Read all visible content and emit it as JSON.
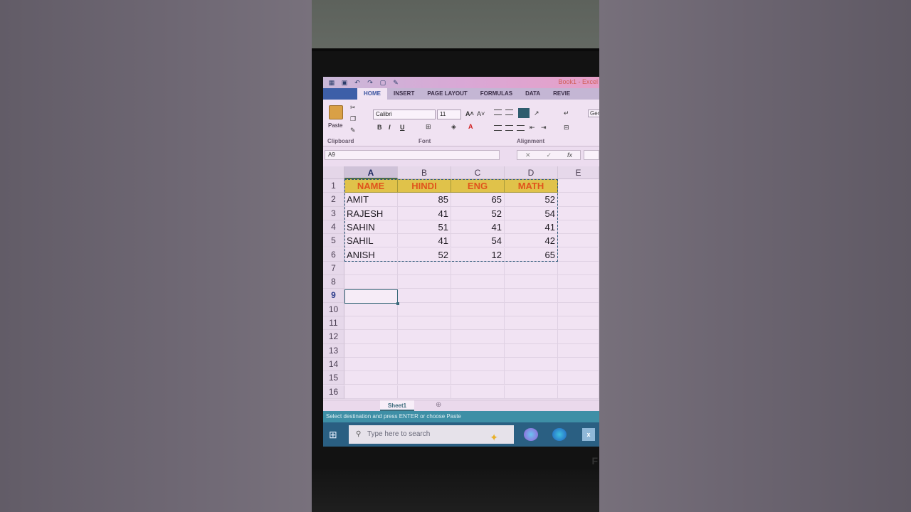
{
  "window": {
    "title": "Book1 - Excel"
  },
  "ribbon": {
    "tabs": [
      "HOME",
      "INSERT",
      "PAGE LAYOUT",
      "FORMULAS",
      "DATA",
      "REVIE"
    ],
    "active_tab": "HOME",
    "paste_label": "Paste",
    "font_name": "Calibri",
    "font_size": "11",
    "groups": {
      "clipboard": "Clipboard",
      "font": "Font",
      "alignment": "Alignment"
    },
    "number_format": "Gen"
  },
  "formula_bar": {
    "name_box": "A9",
    "cancel": "✕",
    "enter": "✓",
    "fx": "fx"
  },
  "sheet": {
    "columns": [
      "A",
      "B",
      "C",
      "D",
      "E"
    ],
    "rows": [
      {
        "n": "1",
        "cells": [
          "NAME",
          "HINDI",
          "ENG",
          "MATH"
        ]
      },
      {
        "n": "2",
        "cells": [
          "AMIT",
          "85",
          "65",
          "52"
        ]
      },
      {
        "n": "3",
        "cells": [
          "RAJESH",
          "41",
          "52",
          "54"
        ]
      },
      {
        "n": "4",
        "cells": [
          "SAHIN",
          "51",
          "41",
          "41"
        ]
      },
      {
        "n": "5",
        "cells": [
          "SAHIL",
          "41",
          "54",
          "42"
        ]
      },
      {
        "n": "6",
        "cells": [
          "ANISH",
          "52",
          "12",
          "65"
        ]
      },
      {
        "n": "7",
        "cells": [
          "",
          "",
          "",
          ""
        ]
      },
      {
        "n": "8",
        "cells": [
          "",
          "",
          "",
          ""
        ]
      },
      {
        "n": "9",
        "cells": [
          "",
          "",
          "",
          ""
        ]
      },
      {
        "n": "10",
        "cells": [
          "",
          "",
          "",
          ""
        ]
      },
      {
        "n": "11",
        "cells": [
          "",
          "",
          "",
          ""
        ]
      },
      {
        "n": "12",
        "cells": [
          "",
          "",
          "",
          ""
        ]
      },
      {
        "n": "13",
        "cells": [
          "",
          "",
          "",
          ""
        ]
      },
      {
        "n": "14",
        "cells": [
          "",
          "",
          "",
          ""
        ]
      },
      {
        "n": "15",
        "cells": [
          "",
          "",
          "",
          ""
        ]
      },
      {
        "n": "16",
        "cells": [
          "",
          "",
          "",
          ""
        ]
      }
    ],
    "selected_cell": "A9",
    "header_fill": "#e0c24a",
    "header_text_color": "#e0541c"
  },
  "sheet_tabs": {
    "active": "Sheet1",
    "add": "⊕"
  },
  "status_bar": {
    "text": "Select destination and press ENTER or choose Paste"
  },
  "taskbar": {
    "search_placeholder": "Type here to search",
    "excel_label": "x"
  }
}
